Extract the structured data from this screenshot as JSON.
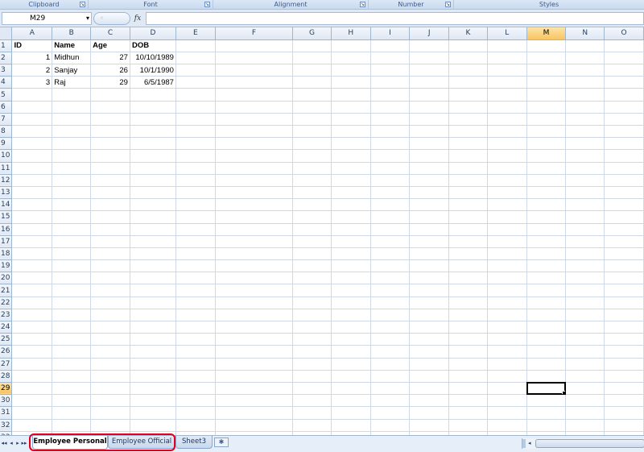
{
  "ribbon": {
    "groups": [
      "Clipboard",
      "Font",
      "Alignment",
      "Number",
      "Styles"
    ],
    "launcher_glyph": "↘"
  },
  "formula_bar": {
    "name_box": "M29",
    "dropdown_glyph": "▾",
    "fx_button": "𝘧𝓍",
    "fx_label": "fx",
    "formula_value": ""
  },
  "grid": {
    "columns": [
      "A",
      "B",
      "C",
      "D",
      "E",
      "F",
      "G",
      "H",
      "I",
      "J",
      "K",
      "L",
      "M",
      "N",
      "O"
    ],
    "active_column": "M",
    "active_row": 29,
    "row_count": 33,
    "header_row": [
      "ID",
      "Name",
      "Age",
      "DOB"
    ],
    "rows": [
      [
        "1",
        "Midhun",
        "27",
        "10/10/1989"
      ],
      [
        "2",
        "Sanjay",
        "26",
        "10/1/1990"
      ],
      [
        "3",
        "Raj",
        "29",
        "6/5/1987"
      ]
    ]
  },
  "sheet_tabs": {
    "nav": [
      "◂◂",
      "◂",
      "▸",
      "▸▸"
    ],
    "tabs": [
      "Employee Personal",
      "Employee Official",
      "Sheet3"
    ],
    "active": "Employee Personal",
    "new_sheet_glyph": "✱"
  },
  "colors": {
    "ribbon_bg": "#dbe7f6",
    "header_bg": "#dfe8f4",
    "active_header": "#f8c461",
    "gridline": "#d0d7e5",
    "highlight": "#e4001b"
  }
}
